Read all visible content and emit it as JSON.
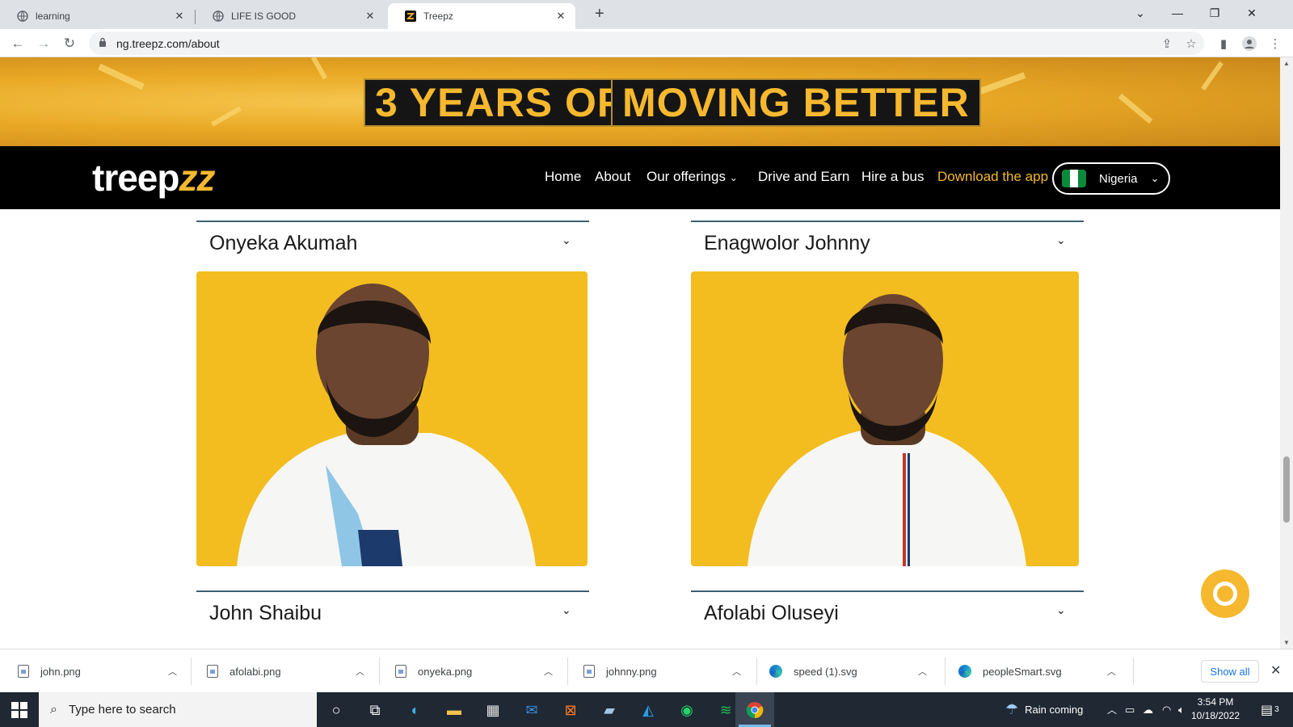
{
  "browser": {
    "tabs": [
      {
        "title": "learning",
        "active": false
      },
      {
        "title": "LIFE IS GOOD",
        "active": false
      },
      {
        "title": "Treepz",
        "active": true
      }
    ],
    "url": "ng.treepz.com/about"
  },
  "banner": {
    "part1": "3 YEARS OF",
    "part2": "MOVING BETTER"
  },
  "site": {
    "logo_main": "treep",
    "logo_accent": "zz",
    "nav": {
      "home": "Home",
      "about": "About",
      "offerings": "Our offerings",
      "drive": "Drive and Earn",
      "hire": "Hire a bus",
      "download": "Download the app"
    },
    "country": "Nigeria",
    "colors": {
      "accent": "#f5b82e",
      "nav_bg": "#000000",
      "photo_bg": "#f3bd1f"
    }
  },
  "team": [
    {
      "name": "Onyeka Akumah"
    },
    {
      "name": "Enagwolor Johnny"
    },
    {
      "name": "John Shaibu"
    },
    {
      "name": "Afolabi Oluseyi"
    }
  ],
  "downloads": {
    "files": [
      {
        "name": "john.png",
        "icon": "file-icon"
      },
      {
        "name": "afolabi.png",
        "icon": "file-icon"
      },
      {
        "name": "onyeka.png",
        "icon": "file-icon"
      },
      {
        "name": "johnny.png",
        "icon": "file-icon"
      },
      {
        "name": "speed (1).svg",
        "icon": "edge-icon"
      },
      {
        "name": "peopleSmart.svg",
        "icon": "edge-icon"
      }
    ],
    "show_all": "Show all"
  },
  "taskbar": {
    "search_placeholder": "Type here to search",
    "weather": "Rain coming",
    "time": "3:54 PM",
    "date": "10/18/2022",
    "notifications": "3"
  }
}
